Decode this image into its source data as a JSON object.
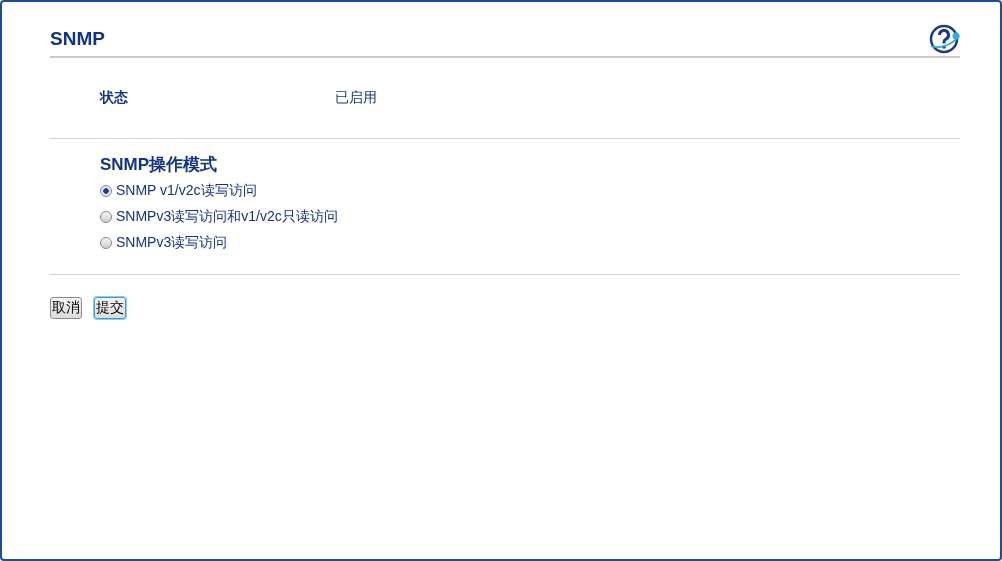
{
  "title": "SNMP",
  "status": {
    "label": "状态",
    "value": "已启用"
  },
  "mode": {
    "heading": "SNMP操作模式",
    "options": [
      {
        "label": "SNMP v1/v2c读写访问",
        "selected": true
      },
      {
        "label": "SNMPv3读写访问和v1/v2c只读访问",
        "selected": false
      },
      {
        "label": "SNMPv3读写访问",
        "selected": false
      }
    ]
  },
  "buttons": [
    {
      "label": "取消",
      "focused": false
    },
    {
      "label": "提交",
      "focused": true
    }
  ]
}
